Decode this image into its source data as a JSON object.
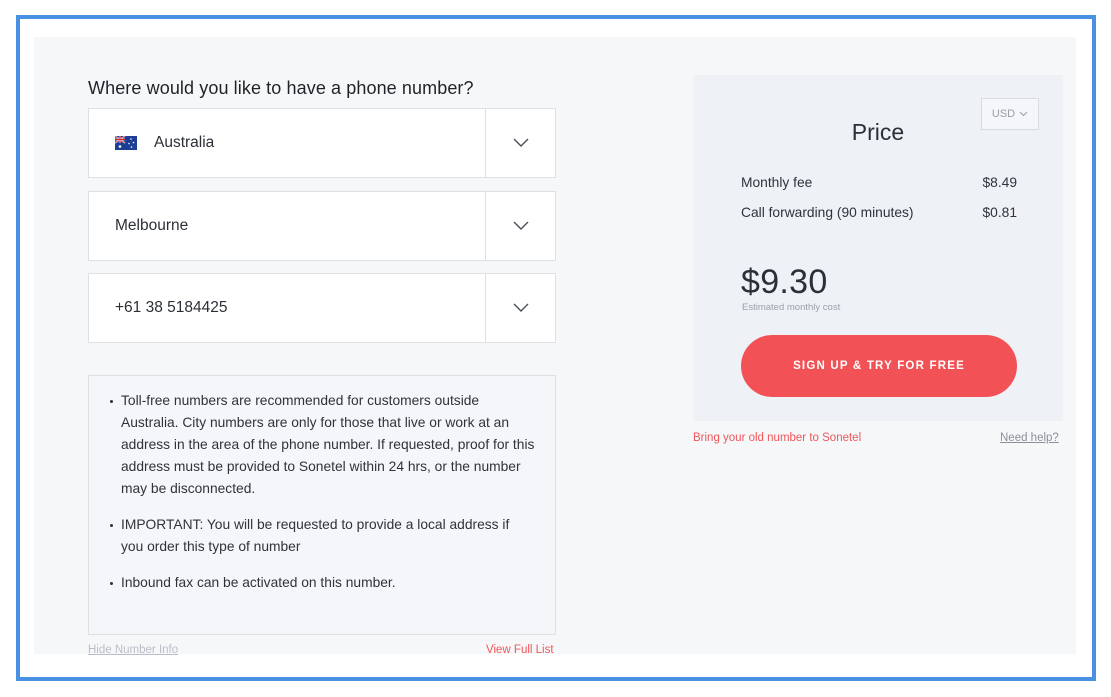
{
  "form": {
    "heading": "Where would you like to have a phone number?",
    "country": {
      "value": "Australia",
      "flag": "australia-flag-icon"
    },
    "city": {
      "value": "Melbourne"
    },
    "number": {
      "value": "+61 38 5184425"
    }
  },
  "info": {
    "items": [
      "Toll-free numbers are recommended for customers outside Australia. City numbers are only for those that live or work at an address in the area of the phone number. If requested, proof for this address must be provided to Sonetel within 24 hrs, or the number may be disconnected.",
      "IMPORTANT: You will be requested to provide a local address if you order this type of number",
      "Inbound fax can be activated on this number."
    ],
    "hide_link": "Hide Number Info",
    "full_list_link": "View Full List"
  },
  "price": {
    "currency": "USD",
    "title": "Price",
    "lines": [
      {
        "label": "Monthly fee",
        "amount": "$8.49"
      },
      {
        "label": "Call forwarding (90 minutes)",
        "amount": "$0.81"
      }
    ],
    "total": "$9.30",
    "total_caption": "Estimated monthly cost",
    "cta": "SIGN UP & TRY FOR FREE"
  },
  "links": {
    "bring_number": "Bring your old number to Sonetel",
    "help": "Need help?"
  },
  "colors": {
    "accent": "#f25255",
    "frame": "#4a90e2",
    "card_bg": "#eef1f5"
  }
}
